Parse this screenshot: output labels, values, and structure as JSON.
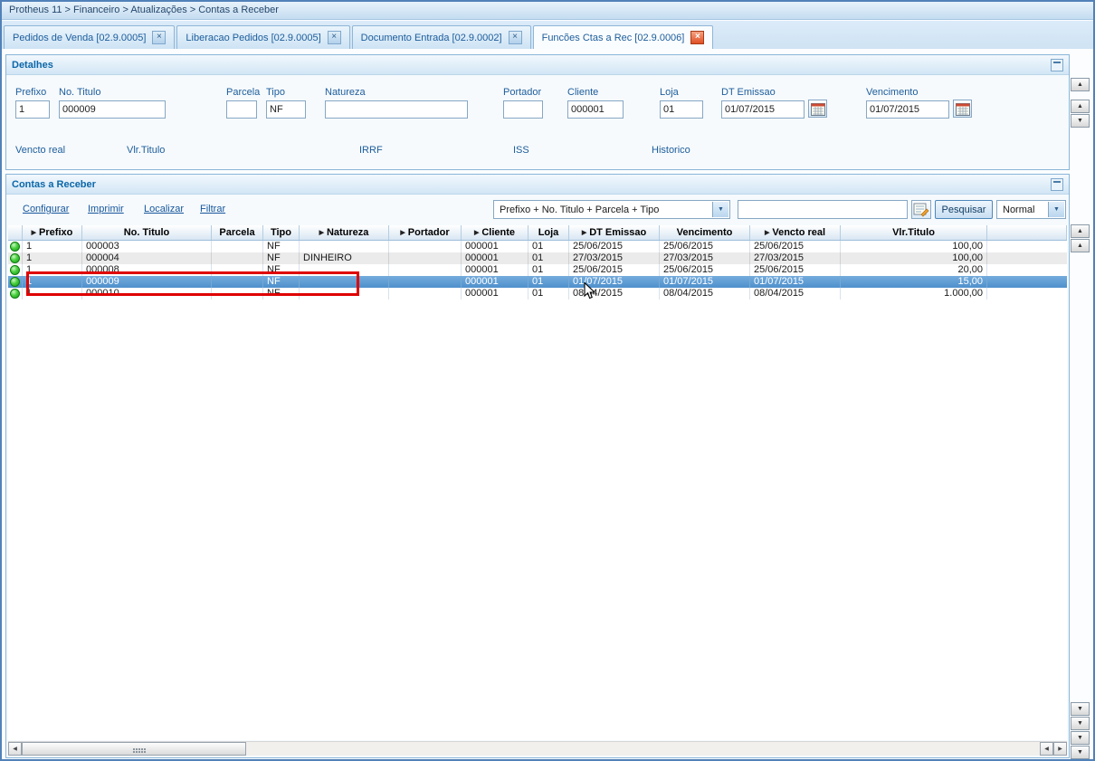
{
  "window": {
    "breadcrumb": "Protheus 11 > Financeiro > Atualizações > Contas a Receber"
  },
  "icons": {
    "close": "×",
    "combo_arrow": "▼",
    "sort_arrow": "▶",
    "up_arrow": "▲",
    "down_arrow": "▼",
    "left_arrow": "◀",
    "right_arrow": "▶"
  },
  "colors": {
    "selection": "#5a9bd4",
    "annotation": "#df0000",
    "status_ok_green": "#2db52d",
    "panel_title_blue": "#0b67a9"
  },
  "tabs": [
    {
      "label": "Pedidos de Venda [02.9.0005]",
      "active": false
    },
    {
      "label": "Liberacao Pedidos [02.9.0005]",
      "active": false
    },
    {
      "label": "Documento Entrada [02.9.0002]",
      "active": false
    },
    {
      "label": "Funcões Ctas a Rec [02.9.0006]",
      "active": true
    }
  ],
  "detalhes": {
    "title": "Detalhes",
    "fields": [
      {
        "label": "Prefixo",
        "value": "1",
        "calendar": false
      },
      {
        "label": "No. Titulo",
        "value": "000009",
        "calendar": false
      },
      {
        "label": "Parcela",
        "value": "",
        "calendar": false
      },
      {
        "label": "Tipo",
        "value": "NF",
        "calendar": false
      },
      {
        "label": "Natureza",
        "value": "",
        "calendar": false
      },
      {
        "label": "Portador",
        "value": "",
        "calendar": false
      },
      {
        "label": "Cliente",
        "value": "000001",
        "calendar": false
      },
      {
        "label": "Loja",
        "value": "01",
        "calendar": false
      },
      {
        "label": "DT Emissao",
        "value": "01/07/2015",
        "calendar": true
      },
      {
        "label": "Vencimento",
        "value": "01/07/2015",
        "calendar": true
      }
    ],
    "secondary_labels": [
      "Vencto real",
      "Vlr.Titulo",
      "IRRF",
      "ISS",
      "Historico"
    ]
  },
  "grid": {
    "title": "Contas a Receber",
    "toolbar": {
      "links": [
        "Configurar",
        "Imprimir",
        "Localizar",
        "Filtrar"
      ],
      "index_selector": "Prefixo + No. Titulo + Parcela + Tipo",
      "search_value": "",
      "search_button": "Pesquisar",
      "view_selector": "Normal"
    },
    "columns": [
      {
        "label": "Prefixo",
        "arrow": true
      },
      {
        "label": "No. Titulo",
        "arrow": false
      },
      {
        "label": "Parcela",
        "arrow": false
      },
      {
        "label": "Tipo",
        "arrow": false
      },
      {
        "label": "Natureza",
        "arrow": true
      },
      {
        "label": "Portador",
        "arrow": true
      },
      {
        "label": "Cliente",
        "arrow": true
      },
      {
        "label": "Loja",
        "arrow": false
      },
      {
        "label": "DT Emissao",
        "arrow": true
      },
      {
        "label": "Vencimento",
        "arrow": false
      },
      {
        "label": "Vencto real",
        "arrow": true
      },
      {
        "label": "Vlr.Titulo",
        "arrow": false
      }
    ],
    "rows": [
      {
        "selected": false,
        "cells": [
          "1",
          "000003",
          "",
          "NF",
          "",
          "",
          "000001",
          "01",
          "25/06/2015",
          "25/06/2015",
          "25/06/2015",
          "100,00"
        ]
      },
      {
        "selected": false,
        "cells": [
          "1",
          "000004",
          "",
          "NF",
          "DINHEIRO",
          "",
          "000001",
          "01",
          "27/03/2015",
          "27/03/2015",
          "27/03/2015",
          "100,00"
        ]
      },
      {
        "selected": false,
        "cells": [
          "1",
          "000008",
          "",
          "NF",
          "",
          "",
          "000001",
          "01",
          "25/06/2015",
          "25/06/2015",
          "25/06/2015",
          "20,00"
        ]
      },
      {
        "selected": true,
        "cells": [
          "1",
          "000009",
          "",
          "NF",
          "",
          "",
          "000001",
          "01",
          "01/07/2015",
          "01/07/2015",
          "01/07/2015",
          "15,00"
        ]
      },
      {
        "selected": false,
        "cells": [
          "1",
          "000010",
          "",
          "NF",
          "",
          "",
          "000001",
          "01",
          "08/04/2015",
          "08/04/2015",
          "08/04/2015",
          "1.000,00"
        ]
      }
    ]
  }
}
